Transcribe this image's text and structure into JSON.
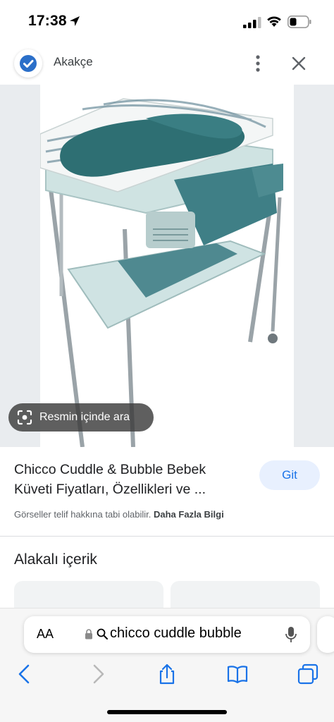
{
  "status_bar": {
    "time": "17:38",
    "icons": [
      "location-arrow-icon",
      "signal-icon",
      "wifi-icon",
      "battery-icon"
    ]
  },
  "header": {
    "site_name": "Akakçe",
    "logo_icon": "checkmark-badge-icon",
    "more_icon": "vertical-dots-icon",
    "close_icon": "close-icon"
  },
  "image": {
    "lens_label": "Resmin içinde ara"
  },
  "result": {
    "title_line1": "Chicco Cuddle & Bubble Bebek",
    "title_line2": "Küveti Fiyatları, Özellikleri ve ...",
    "go_label": "Git",
    "copyright": "Görseller telif hakkına tabi olabilir.",
    "more_info": "Daha Fazla Bilgi"
  },
  "related": {
    "heading": "Alakalı içerik"
  },
  "safari": {
    "aa_label": "AA",
    "url_text": "chicco cuddle bubble"
  },
  "colors": {
    "accent_blue": "#1a73e8",
    "button_bg": "#e8f0fe",
    "product_teal": "#2e6f73",
    "logo_blue": "#2b6fc9"
  }
}
